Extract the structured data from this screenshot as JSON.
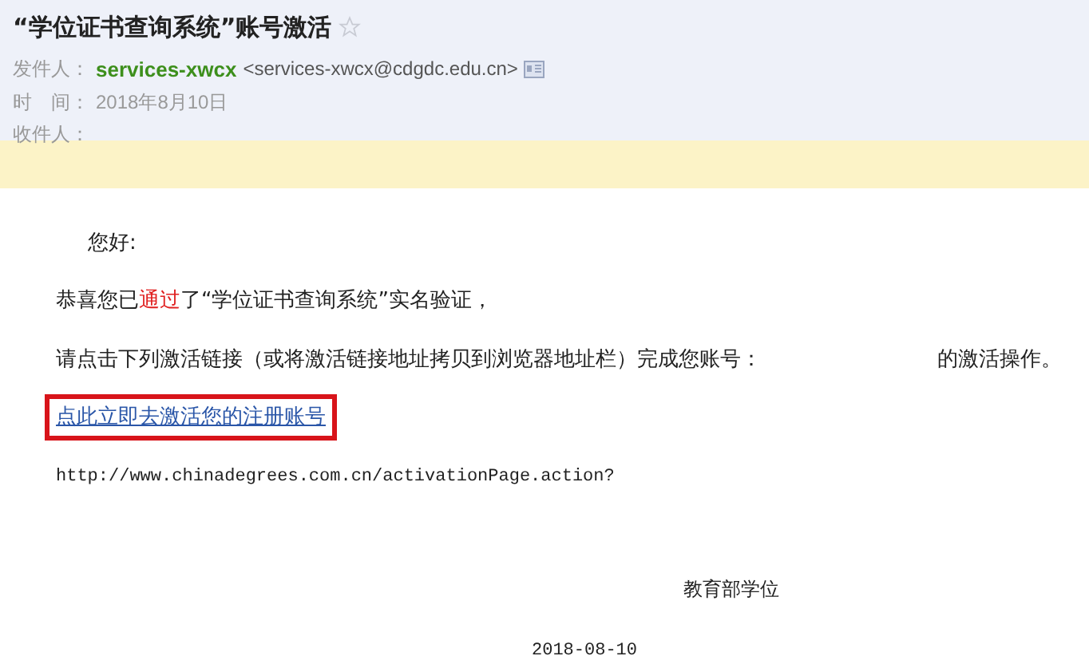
{
  "email": {
    "subject": "“学位证书查询系统”账号激活",
    "starred": false,
    "sender_label": "发件人：",
    "sender_name": "services-xwcx",
    "sender_address": "<services-xwcx@cdgdc.edu.cn>",
    "time_label": "时　间：",
    "time": "2018年8月10日",
    "recipient_label": "收件人："
  },
  "body": {
    "greeting": "您好:",
    "congrats": [
      {
        "text": "恭喜您已",
        "highlight": false
      },
      {
        "text": "通过",
        "highlight": true
      },
      {
        "text": "了“学位证书查询系统”实名验证，",
        "highlight": false
      }
    ],
    "instruction": "请点击下列激活链接（或将激活链接地址拷贝到浏览器地址栏）完成您账号：",
    "instruction_end": "的激活操作。",
    "link": "点此立即去激活您的注册账号",
    "url": "http://www.chinadegrees.com.cn/activationPage.action?",
    "signature": "教育部学位",
    "date": "2018-08-10"
  }
}
